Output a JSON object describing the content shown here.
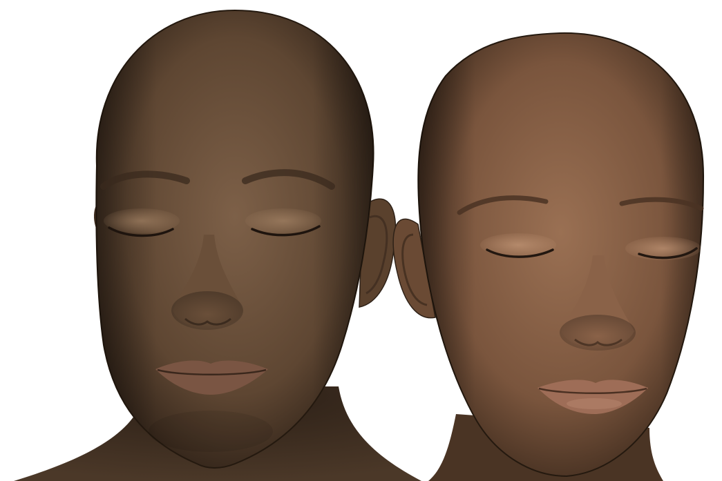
{
  "scene": {
    "background_color": "#ffffff",
    "subjects": [
      {
        "id": "left-face",
        "skin_light": "#7d6048",
        "skin_mid": "#5e4632",
        "skin_dark": "#2e2117",
        "lip_color": "#7a5543",
        "brow_color": "#3a2a1e",
        "lash_color": "#1e140e"
      },
      {
        "id": "right-face",
        "skin_light": "#9a7053",
        "skin_mid": "#7a553d",
        "skin_dark": "#3a281b",
        "lip_color": "#9e6d57",
        "brow_color": "#4a3223",
        "lash_color": "#221710"
      }
    ]
  }
}
